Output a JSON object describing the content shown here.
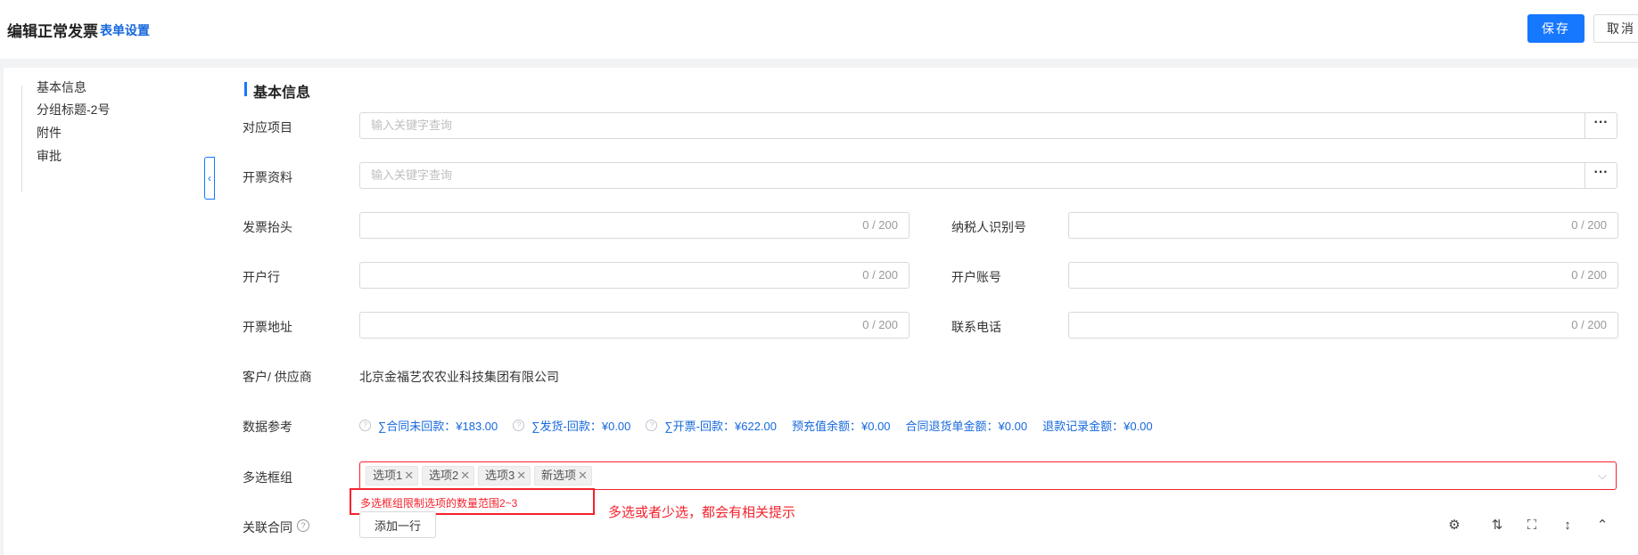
{
  "header": {
    "title": "编辑正常发票",
    "form_settings": "表单设置",
    "save_label": "保存",
    "cancel_label": "取消"
  },
  "sidebar": {
    "items": [
      {
        "label": "基本信息"
      },
      {
        "label": "分组标题-2号"
      },
      {
        "label": "附件"
      },
      {
        "label": "审批"
      }
    ],
    "collapse_glyph": "‹"
  },
  "section": {
    "title": "基本信息"
  },
  "form": {
    "project": {
      "label": "对应项目",
      "placeholder": "输入关键字查询"
    },
    "billing_info": {
      "label": "开票资料",
      "placeholder": "输入关键字查询"
    },
    "invoice_header": {
      "label": "发票抬头",
      "count": "0 / 200"
    },
    "taxpayer_id": {
      "label": "纳税人识别号",
      "count": "0 / 200"
    },
    "bank": {
      "label": "开户行",
      "count": "0 / 200"
    },
    "bank_account": {
      "label": "开户账号",
      "count": "0 / 200"
    },
    "invoice_address": {
      "label": "开票地址",
      "count": "0 / 200"
    },
    "phone": {
      "label": "联系电话",
      "count": "0 / 200"
    },
    "customer": {
      "label": "客户/ 供应商",
      "value": "北京金福艺农农业科技集团有限公司"
    },
    "data_ref": {
      "label": "数据参考",
      "items": [
        "∑合同未回款：¥183.00",
        "∑发货-回款：¥0.00",
        "∑开票-回款：¥622.00",
        "预充值余额：¥0.00",
        "合同退货单金额：¥0.00",
        "退款记录金额：¥0.00"
      ]
    },
    "multi_select": {
      "label": "多选框组",
      "tags": [
        "选项1",
        "选项2",
        "选项3",
        "新选项"
      ],
      "error": "多选框组限制选项的数量范围2~3",
      "annotation": "多选或者少选，都会有相关提示"
    },
    "related_contract": {
      "label": "关联合同",
      "add_row": "添加一行"
    }
  },
  "icons": {
    "dots": "···",
    "help": "?",
    "tag_close": "✕",
    "chevron": "⌵",
    "gear": "⚙",
    "density": "⇅",
    "fullscreen": "⛶",
    "resize": "↕",
    "collapse": "⌃"
  },
  "colors": {
    "primary": "#1677ff",
    "link": "#1668dc",
    "error": "#f5222d"
  }
}
